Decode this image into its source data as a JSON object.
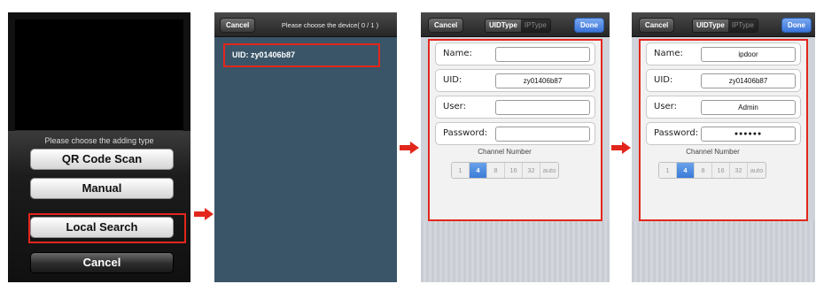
{
  "screen1": {
    "title": "Please choose the adding type",
    "buttons": [
      "QR Code Scan",
      "Manual",
      "Local Search"
    ],
    "cancel": "Cancel"
  },
  "screen2": {
    "cancel": "Cancel",
    "title": "Please choose the device( 0 / 1 )",
    "device": "UID: zy01406b87"
  },
  "screen3": {
    "cancel": "Cancel",
    "seg_uid": "UIDType",
    "seg_ip": "IPType",
    "done": "Done",
    "fields": [
      {
        "label": "Name:",
        "value": ""
      },
      {
        "label": "UID:",
        "value": "zy01406b87"
      },
      {
        "label": "User:",
        "value": ""
      },
      {
        "label": "Password:",
        "value": ""
      }
    ],
    "channel_title": "Channel Number",
    "channels": [
      "1",
      "4",
      "8",
      "16",
      "32",
      "auto"
    ],
    "selected_channel": "4"
  },
  "screen4": {
    "cancel": "Cancel",
    "seg_uid": "UIDType",
    "seg_ip": "IPType",
    "done": "Done",
    "fields": [
      {
        "label": "Name:",
        "value": "ipdoor"
      },
      {
        "label": "UID:",
        "value": "zy01406b87"
      },
      {
        "label": "User:",
        "value": "Admin"
      },
      {
        "label": "Password:",
        "value": "●●●●●●"
      }
    ],
    "channel_title": "Channel Number",
    "channels": [
      "1",
      "4",
      "8",
      "16",
      "32",
      "auto"
    ],
    "selected_channel": "4"
  },
  "colors": {
    "highlight": "#e3261b",
    "list_bg": "#3a5568",
    "accent": "#3a7bd8"
  }
}
